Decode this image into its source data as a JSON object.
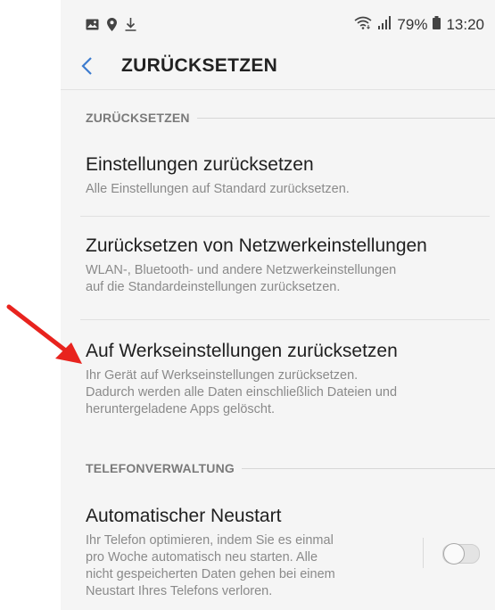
{
  "status_bar": {
    "battery": "79%",
    "time": "13:20",
    "icons_left": [
      "image-icon",
      "location-icon",
      "download-icon"
    ],
    "icons_right": [
      "wifi-icon",
      "signal-icon",
      "battery-icon"
    ]
  },
  "header": {
    "title": "ZURÜCKSETZEN",
    "back_icon": "chevron-left-icon"
  },
  "sections": [
    {
      "label": "ZURÜCKSETZEN",
      "items": [
        {
          "title": "Einstellungen zurücksetzen",
          "desc": [
            "Alle Einstellungen auf Standard zurücksetzen."
          ]
        },
        {
          "title": "Zurücksetzen von Netzwerkeinstellungen",
          "desc": [
            "WLAN-, Bluetooth- und andere Netzwerkeinstellungen",
            "auf die Standardeinstellungen zurücksetzen."
          ]
        },
        {
          "title": "Auf Werkseinstellungen zurücksetzen",
          "desc": [
            "Ihr Gerät auf Werkseinstellungen zurücksetzen.",
            "Dadurch werden alle Daten einschließlich Dateien und",
            "heruntergeladene Apps gelöscht."
          ]
        }
      ]
    },
    {
      "label": "TELEFONVERWALTUNG",
      "items": [
        {
          "title": "Automatischer Neustart",
          "desc": [
            "Ihr Telefon optimieren, indem Sie es einmal",
            "pro Woche automatisch neu starten. Alle",
            "nicht gespeicherten Daten gehen bei einem",
            "Neustart Ihres Telefons verloren."
          ],
          "toggle_on": false
        }
      ]
    }
  ],
  "colors": {
    "accent": "#3d7ccf",
    "annotation_arrow": "#e8231e"
  }
}
